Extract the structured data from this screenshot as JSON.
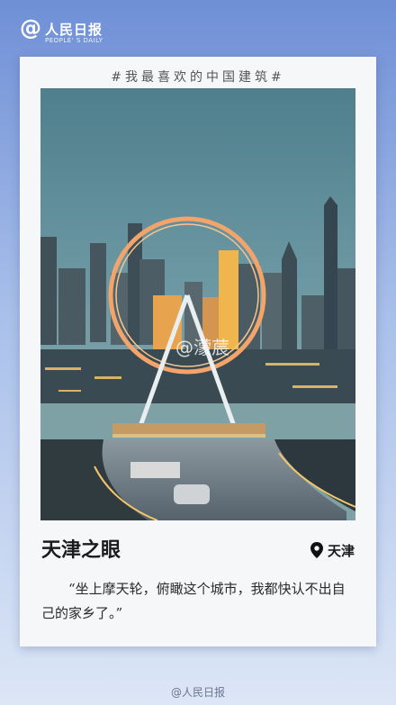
{
  "brand": {
    "name": "人民日报",
    "subtitle": "PEOPLE' S DAILY"
  },
  "card": {
    "topic": "#我最喜欢的中国建筑#",
    "photo_watermark": "@濛莀",
    "title": "天津之眼",
    "location": "天津",
    "quote": "“坐上摩天轮，俯瞰这个城市，我都快认不出自己的家乡了。”"
  },
  "footer": {
    "source": "@人民日报"
  },
  "icons": {
    "brand_logo": "weibo-at-logo-icon",
    "location": "map-pin-icon"
  },
  "colors": {
    "page_gradient_top": "#6f8fd6",
    "page_gradient_bottom": "#dce6f6",
    "card": "#f6f7f9",
    "sky": "#5d8a97",
    "river": "#6f7f88",
    "wheel_light": "#f2a46a",
    "city_light": "#f4c56a"
  }
}
